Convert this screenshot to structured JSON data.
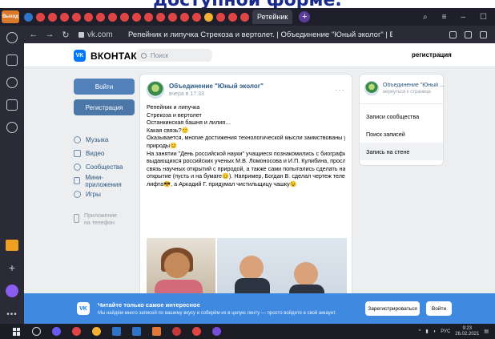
{
  "top_heading": "доступной форме.",
  "browser": {
    "tab_badge": "Выход",
    "active_tab": "Ретейник",
    "url": "vk.com",
    "page_title": "Репейник и липучка Стрекоза и вертолет. | Объединение \"Юный эколог\" | ВКонтакте",
    "window_controls": [
      "⌕",
      "≡",
      "–",
      "☐"
    ]
  },
  "vk": {
    "logo_text": "ВКОНТАКТЕ",
    "search_placeholder": "Поиск",
    "register_link": "регистрация",
    "login_button": "Войти",
    "register_button": "Регистрация",
    "menu": [
      {
        "label": "Музыка",
        "icon": "music-icon"
      },
      {
        "label": "Видео",
        "icon": "video-icon"
      },
      {
        "label": "Сообщества",
        "icon": "groups-icon"
      },
      {
        "label": "Мини-приложения",
        "icon": "apps-icon"
      },
      {
        "label": "Игры",
        "icon": "games-icon"
      }
    ],
    "app_link_line1": "Приложение",
    "app_link_line2": "на телефон",
    "post": {
      "author": "Объединение \"Юный эколог\"",
      "time": "вчера в 17:33",
      "lines": [
        "Репейник и липучка",
        "Стрекоза и вертолет",
        "Останкинская башня и лилия…",
        "Какая связь?🙂",
        "Оказывается, многие достижения технологической мысли заимствованы у",
        "природы😊",
        "На занятии \"День российской науки\" учащиеся познакомились с биографиями",
        "выдающихся российских ученых  М.В. Ломоносова и И.П. Кулибина, проследили",
        "связь научных открытий с природой, а также сами попытались сделать научное",
        "открытие (пусть и на бумаге😊). Например, Богдан В. сделал чертеж телепорта-",
        "лифта😎, а Аркадий Г. придумал чистильщицу чашку😉"
      ]
    },
    "right_col": {
      "name": "Объединение \"Юный ...",
      "sub": "вернуться к странице",
      "items": [
        "Записи сообщества",
        "Поиск записей",
        "Запись на стене"
      ]
    },
    "banner": {
      "title": "Читайте только самое интересное",
      "subtitle": "Мы найдём много записей по вашему вкусу и соберём их в целую ленту — просто войдите в свой аккаунт.",
      "register_button": "Зарегистрироваться",
      "login_button": "Войти"
    }
  },
  "taskbar": {
    "tray_lang": "РУС",
    "time": "9:23",
    "date": "26.02.2021"
  },
  "colors": {
    "vk_blue": "#0077ff",
    "button_blue": "#5181b8",
    "banner_blue": "#3f8ae0",
    "link_blue": "#2a5885"
  }
}
